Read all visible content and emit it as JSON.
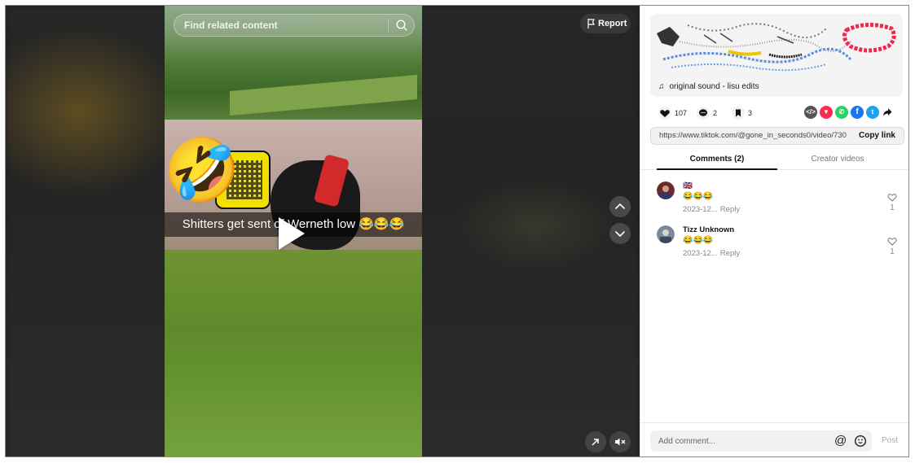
{
  "search": {
    "placeholder": "Find related content"
  },
  "report_label": "Report",
  "video": {
    "caption": "Shitters get sent of Werneth low 😂😂😂",
    "icons": [
      "play-icon",
      "chevron-up-icon",
      "chevron-down-icon",
      "floating-player-icon",
      "muted-speaker-icon"
    ]
  },
  "description": {
    "sound": "original sound - lisu edits"
  },
  "actions": {
    "likes": "107",
    "comments": "2",
    "saves": "3"
  },
  "share_icons": [
    "embed-icon",
    "send-to-friends-icon",
    "whatsapp-icon",
    "facebook-icon",
    "twitter-icon",
    "share-arrow-icon"
  ],
  "share_colors": {
    "embed": "#555555",
    "send": "#fe2c55",
    "whatsapp": "#25d366",
    "facebook": "#1877f2",
    "twitter": "#1da1f2"
  },
  "link": {
    "url": "https://www.tiktok.com/@gone_in_seconds0/video/730...",
    "copy_label": "Copy link"
  },
  "tabs": [
    {
      "label": "Comments (2)",
      "active": true
    },
    {
      "label": "Creator videos",
      "active": false
    }
  ],
  "comments": [
    {
      "user": "🇬🇧",
      "text": "😂😂😂",
      "date": "2023-12...",
      "reply": "Reply",
      "likes": "1"
    },
    {
      "user": "Tizz Unknown",
      "text": "😂😂😂",
      "date": "2023-12...",
      "reply": "Reply",
      "likes": "1"
    }
  ],
  "footer": {
    "placeholder": "Add comment...",
    "at_symbol": "@",
    "post_label": "Post"
  }
}
